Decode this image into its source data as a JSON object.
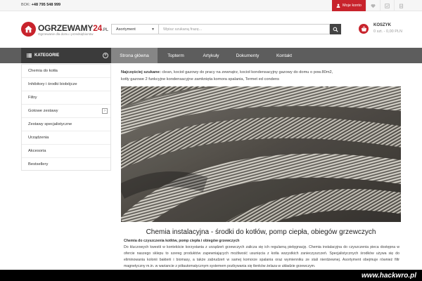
{
  "topbar": {
    "phone_label": "BOK: ",
    "phone_number": "+48 795 548 999",
    "account_label": "Moje konto"
  },
  "header": {
    "logo_title": "OGRZEWAMY",
    "logo_accent": "24",
    "logo_tld": ".PL",
    "logo_subtitle": "Ogrzewanie dla domu i przedsiębiorstw",
    "search_category": "Asortyment",
    "search_placeholder": "Wpisz szukaną frazę...",
    "cart_label": "KOSZYK",
    "cart_total": "0 szt. - 0,00 PLN"
  },
  "nav": {
    "categories_label": "KATEGORIE",
    "tabs": [
      {
        "label": "Strona główna"
      },
      {
        "label": "Topterm"
      },
      {
        "label": "Artykuły"
      },
      {
        "label": "Dokumenty"
      },
      {
        "label": "Kontakt"
      }
    ]
  },
  "sidebar": {
    "items": [
      {
        "label": "Chemia do kotła"
      },
      {
        "label": "Inhibitory i środki biobójcze"
      },
      {
        "label": "Filtry"
      },
      {
        "label": "Gotowe zestawy"
      },
      {
        "label": "Zestawy specjalistyczne"
      },
      {
        "label": "Urządzenia"
      },
      {
        "label": "Akcesoria"
      },
      {
        "label": "Bestsellery"
      }
    ],
    "chevron": "›"
  },
  "main": {
    "recent_label": "Najczęściej szukane:",
    "recent_line1": "clean,  kocioł gazowy do pracy na zewnątrz,  kocioł kondensacyjny gazowy do domu o pow.80m2,",
    "recent_line2": "kotły gazowe 2 funkcyjne kondensacyjne zamknięta komora spalania,  Termet ed condens",
    "title": "Chemia instalacyjna - środki do kotłów, pomp ciepła, obiegów grzewczych",
    "subtitle": "Chemia do czyszczenia kotłów, pomp ciepła i obiegów grzewczych",
    "body": "Do kluczowych kwestii w kontekście korzystania z urządzeń grzewczych zalicza się ich regularną pielęgnację. Chemia instalacyjna do czyszczenia pieca dostępna w ofercie naszego sklepu to szereg produktów zapewniających możliwość usunięcia z kotła wszystkich zanieczyszczeń. Specjalistycznych środków używa się do eliminowania kolonii bakterii i biomasy, a także zabrudzeń w samej komorze spalania oraz wymienniku ze stali nierdzewnej. Asortyment obejmuje również filtr magnetyczny m.in. w wariancie z półautomatycznym systemem pozbywania się tlenków żelaza w układzie grzewczym."
  },
  "watermark": "www.hackwro.pl",
  "colors": {
    "brand_red": "#c8232c",
    "nav_bg": "#5d5d5d",
    "nav_active": "#868686",
    "categories_bg": "#3b3b3b"
  },
  "icons": {
    "account": "user-icon",
    "wishlist": "heart-icon",
    "compare": "check-square-icon",
    "notes": "clipboard-icon",
    "search": "magnifier-icon",
    "cart": "basket-icon",
    "categories": "list-icon"
  }
}
